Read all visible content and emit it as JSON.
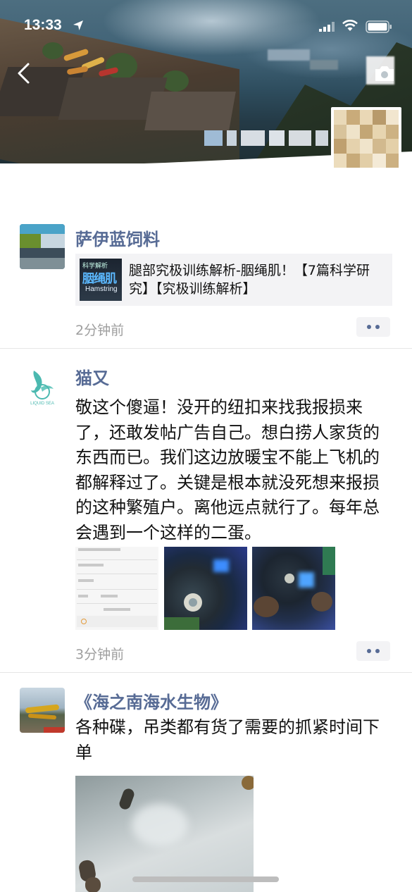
{
  "status_bar": {
    "time": "13:33"
  },
  "posts": [
    {
      "name": "萨伊蓝饲料",
      "link": {
        "title": "腿部究极训练解析-胭绳肌！【7篇科学研究】【究极训练解析】",
        "thumb_label_small": "科学解析",
        "thumb_label_big": "胭绳肌",
        "thumb_label_en": "Hamstring"
      },
      "time": "2分钟前"
    },
    {
      "name": "猫又",
      "text": "敬这个傻逼！没开的纽扣来找我报损来了，还敢发帖广告自己。想白捞人家货的东西而已。我们这边放暖宝不能上飞机的都解释过了。关键是根本就没死想来报损的这种繁殖户。离他远点就行了。每年总会遇到一个这样的二蛋。",
      "avatar_label": "LIQUID SEA",
      "time": "3分钟前"
    },
    {
      "name": "《海之南海水生物》",
      "text": "各种碟，吊类都有货了需要的抓紧时间下单"
    }
  ],
  "colors": {
    "name_link": "#576b95",
    "meta_gray": "#9e9e9e",
    "card_bg": "#f3f3f5"
  },
  "icons": [
    "location-arrow-icon",
    "signal-icon",
    "wifi-icon",
    "battery-icon",
    "back-arrow-icon",
    "camera-icon",
    "more-dots-icon"
  ]
}
